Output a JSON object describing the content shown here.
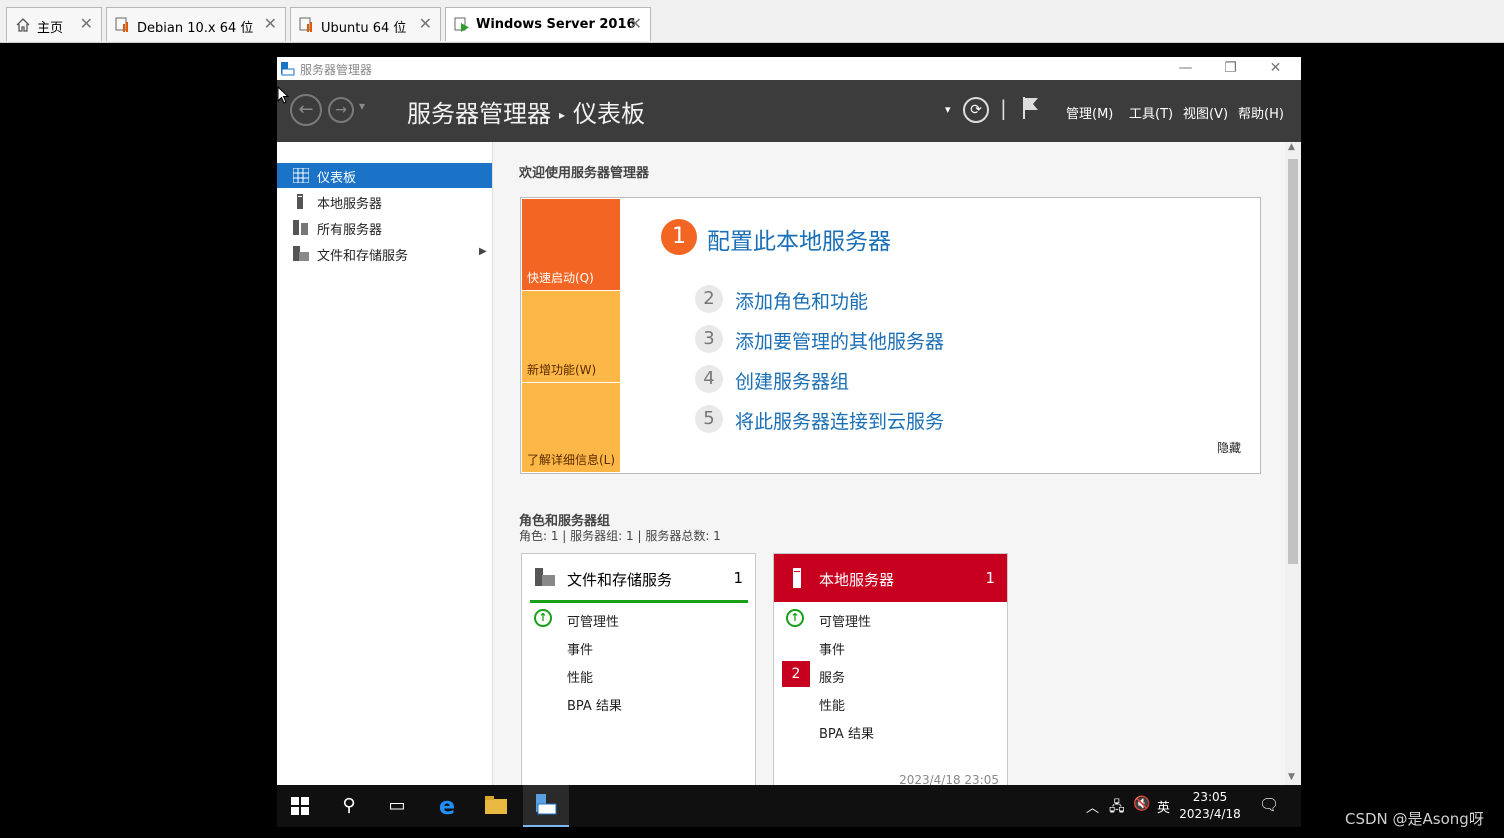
{
  "vm_tabs": [
    {
      "label": "主页",
      "icon": "home-icon"
    },
    {
      "label": "Debian 10.x 64 位",
      "icon": "vm-icon"
    },
    {
      "label": "Ubuntu 64 位",
      "icon": "vm-icon"
    },
    {
      "label": "Windows Server 2016",
      "icon": "vm-running-icon"
    }
  ],
  "window": {
    "title": "服务器管理器",
    "breadcrumb_root": "服务器管理器",
    "breadcrumb_current": "仪表板",
    "menus": [
      "管理(M)",
      "工具(T)",
      "视图(V)",
      "帮助(H)"
    ]
  },
  "nav": {
    "items": [
      {
        "label": "仪表板",
        "icon": "dashboard-icon",
        "selected": true
      },
      {
        "label": "本地服务器",
        "icon": "server-icon"
      },
      {
        "label": "所有服务器",
        "icon": "servers-icon"
      },
      {
        "label": "文件和存储服务",
        "icon": "storage-icon"
      }
    ]
  },
  "welcome": {
    "heading": "欢迎使用服务器管理器",
    "tiles": [
      "快速启动(Q)",
      "新增功能(W)",
      "了解详细信息(L)"
    ],
    "main_step_number": "1",
    "main_step": "配置此本地服务器",
    "steps": [
      {
        "num": "2",
        "label": "添加角色和功能"
      },
      {
        "num": "3",
        "label": "添加要管理的其他服务器"
      },
      {
        "num": "4",
        "label": "创建服务器组"
      },
      {
        "num": "5",
        "label": "将此服务器连接到云服务"
      }
    ],
    "hide": "隐藏"
  },
  "roles": {
    "heading": "角色和服务器组",
    "summary": "角色: 1 | 服务器组: 1 | 服务器总数: 1",
    "cards": [
      {
        "title": "文件和存储服务",
        "count": "1",
        "rows": [
          "可管理性",
          "事件",
          "性能",
          "BPA 结果"
        ]
      },
      {
        "title": "本地服务器",
        "count": "1",
        "rows": [
          "可管理性",
          "事件",
          "服务",
          "性能",
          "BPA 结果"
        ],
        "service_alert": "2",
        "timestamp": "2023/4/18 23:05"
      }
    ]
  },
  "taskbar": {
    "ime": "英",
    "time": "23:05",
    "date": "2023/4/18"
  },
  "watermark": "CSDN @是Asong呀",
  "colors": {
    "accent": "#1a73c7",
    "quickstart": "#f26522",
    "tile_yellow": "#fdb746",
    "alert_red": "#c8001f",
    "ok_green": "#18a018"
  }
}
